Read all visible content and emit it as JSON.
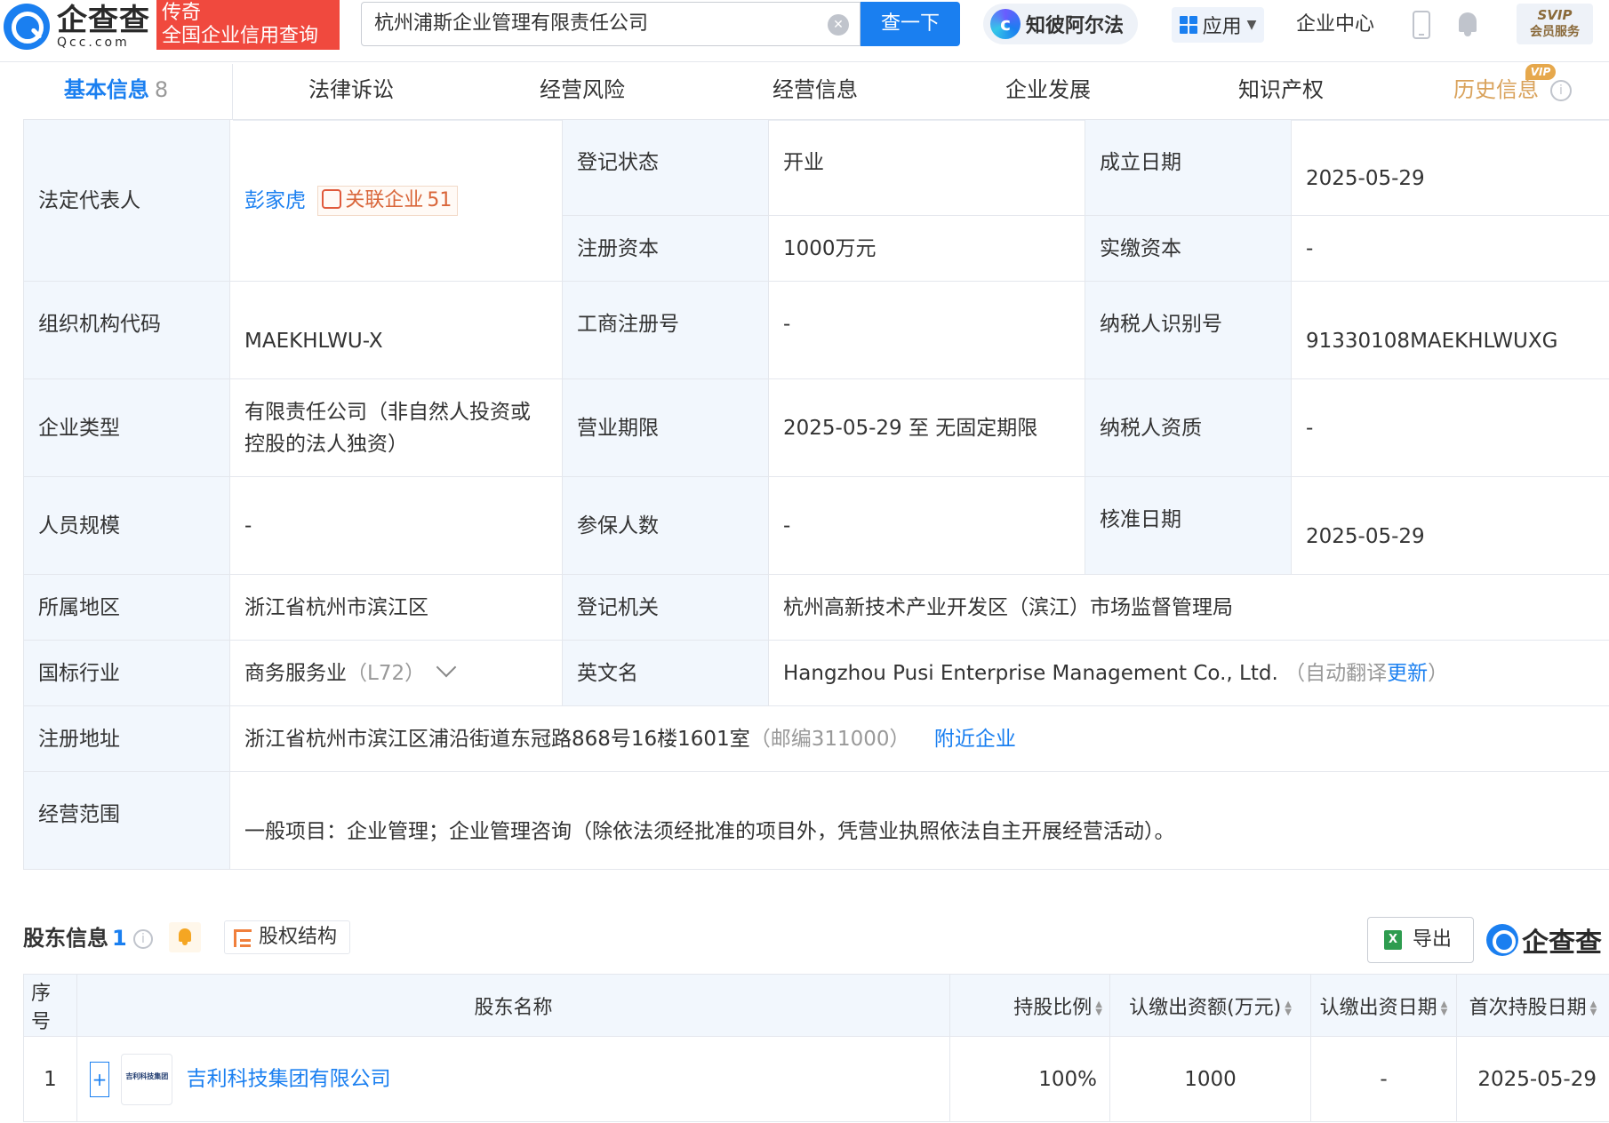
{
  "header": {
    "logo_cn": "企查查",
    "logo_en": "Qcc.com",
    "slogan_line1": "传奇",
    "slogan_line2": "全国企业信用查询",
    "search_value": "杭州浦斯企业管理有限责任公司",
    "search_button": "查一下",
    "zhi_label": "知彼阿尔法",
    "apps_label": "应用",
    "center_label": "企业中心",
    "svip_label": "SVIP",
    "svip_sub": "会员服务"
  },
  "tabs": [
    {
      "label": "基本信息",
      "count": "8"
    },
    {
      "label": "法律诉讼"
    },
    {
      "label": "经营风险"
    },
    {
      "label": "经营信息"
    },
    {
      "label": "企业发展"
    },
    {
      "label": "知识产权"
    },
    {
      "label": "历史信息",
      "badge": "VIP"
    }
  ],
  "info": {
    "legal_rep_label": "法定代表人",
    "legal_rep_name": "彭家虎",
    "related_label": "关联企业",
    "related_count": "51",
    "reg_status_label": "登记状态",
    "reg_status": "开业",
    "found_date_label": "成立日期",
    "found_date": "2025-05-29",
    "reg_capital_label": "注册资本",
    "reg_capital": "1000万元",
    "paid_capital_label": "实缴资本",
    "paid_capital": "-",
    "org_code_label": "组织机构代码",
    "org_code": "MAEKHLWU-X",
    "biz_reg_no_label": "工商注册号",
    "biz_reg_no": "-",
    "taxpayer_id_label": "纳税人识别号",
    "taxpayer_id": "91330108MAEKHLWUXG",
    "company_type_label": "企业类型",
    "company_type": "有限责任公司（非自然人投资或控股的法人独资）",
    "biz_term_label": "营业期限",
    "biz_term": "2025-05-29 至 无固定期限",
    "taxpayer_qual_label": "纳税人资质",
    "taxpayer_qual": "-",
    "staff_size_label": "人员规模",
    "staff_size": "-",
    "insured_label": "参保人数",
    "insured": "-",
    "approve_date_label": "核准日期",
    "approve_date": "2025-05-29",
    "region_label": "所属地区",
    "region": "浙江省杭州市滨江区",
    "reg_authority_label": "登记机关",
    "reg_authority": "杭州高新技术产业开发区（滨江）市场监督管理局",
    "industry_label": "国标行业",
    "industry": "商务服务业",
    "industry_code": "（L72）",
    "english_name_label": "英文名",
    "english_name": "Hangzhou Pusi Enterprise Management Co., Ltd.",
    "english_auto_prefix": "（自动翻译",
    "english_auto_link": "更新",
    "english_auto_suffix": "）",
    "address_label": "注册地址",
    "address": "浙江省杭州市滨江区浦沿街道东冠路868号16楼1601室",
    "postcode": "（邮编311000）",
    "nearby_link": "附近企业",
    "scope_label": "经营范围",
    "scope": "一般项目：企业管理；企业管理咨询（除依法须经批准的项目外，凭营业执照依法自主开展经营活动）。"
  },
  "shareholders": {
    "title": "股东信息",
    "count": "1",
    "structure_button": "股权结构",
    "export_button": "导出",
    "brand": "企查查",
    "columns": [
      "序号",
      "股东名称",
      "持股比例",
      "认缴出资额(万元)",
      "认缴出资日期",
      "首次持股日期"
    ],
    "rows": [
      {
        "index": "1",
        "name": "吉利科技集团有限公司",
        "logo_text": "吉利科技集团",
        "ratio": "100%",
        "amount": "1000",
        "sub_date": "-",
        "first_date": "2025-05-29"
      }
    ]
  }
}
